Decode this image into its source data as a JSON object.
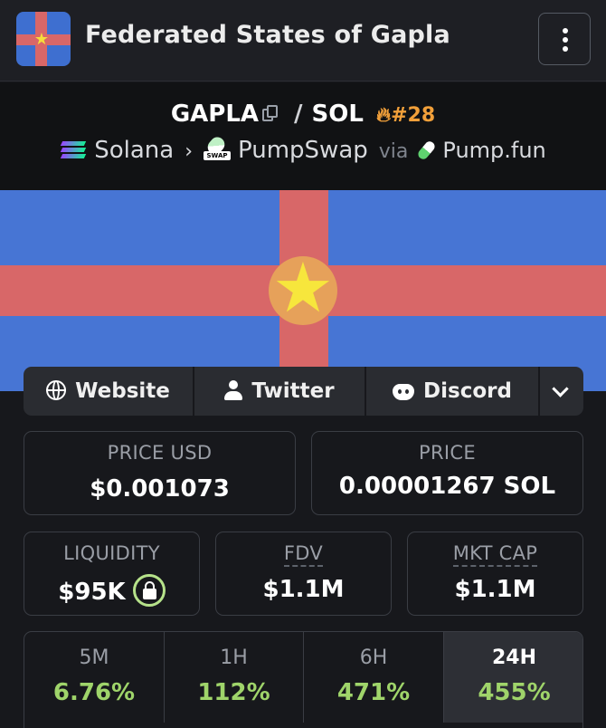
{
  "header": {
    "title": "Federated States of Gapla"
  },
  "pair": {
    "base": "GAPLA",
    "separator": "/",
    "quote": "SOL",
    "rank": "#28"
  },
  "route": {
    "chain": "Solana",
    "dex": "PumpSwap",
    "dex_badge": "SWAP",
    "via": "via",
    "launchpad": "Pump.fun"
  },
  "links": {
    "website": "Website",
    "twitter": "Twitter",
    "discord": "Discord"
  },
  "stats": {
    "price_usd_label": "PRICE USD",
    "price_usd": "$0.001073",
    "price_label": "PRICE",
    "price_sol": "0.00001267 SOL",
    "liquidity_label": "LIQUIDITY",
    "liquidity": "$95K",
    "fdv_label": "FDV",
    "fdv": "$1.1M",
    "mktcap_label": "MKT CAP",
    "mktcap": "$1.1M"
  },
  "periods": [
    {
      "label": "5M",
      "change": "6.76%"
    },
    {
      "label": "1H",
      "change": "112%"
    },
    {
      "label": "6H",
      "change": "471%"
    },
    {
      "label": "24H",
      "change": "455%"
    }
  ],
  "colors": {
    "flag_blue": "#4775d4",
    "flag_red": "#d86768",
    "star_yellow": "#f7e63c",
    "positive_green": "#9fd46a",
    "rank_orange": "#f2a03a"
  },
  "icons": [
    "flag-logo",
    "kebab-menu-icon",
    "copy-icon",
    "fire-icon",
    "solana-icon",
    "pumpswap-icon",
    "pill-icon",
    "globe-icon",
    "person-icon",
    "discord-icon",
    "chevron-down-icon",
    "lock-icon"
  ]
}
